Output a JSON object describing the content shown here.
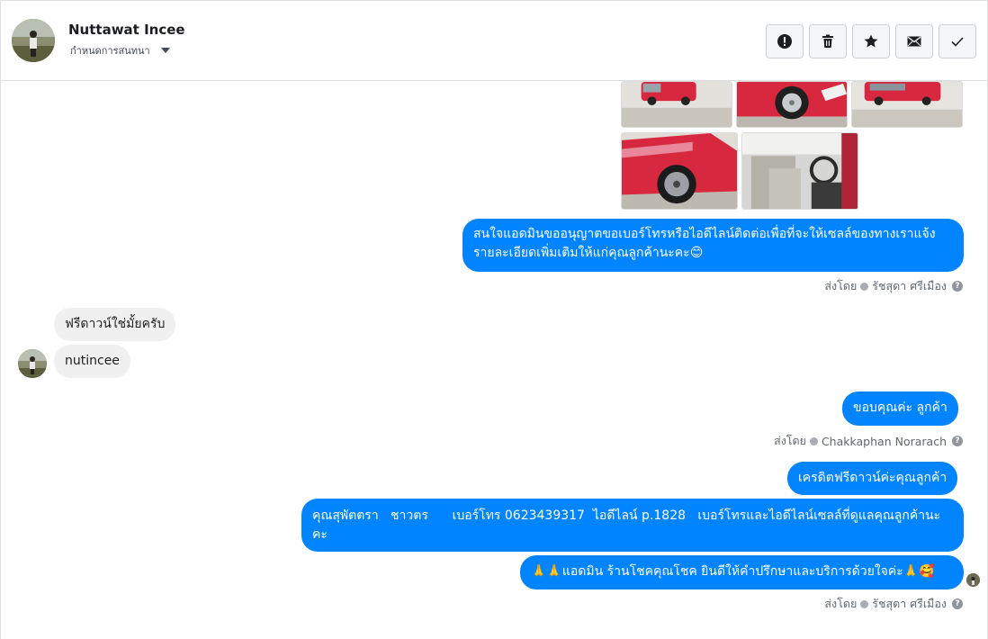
{
  "header": {
    "contact_name": "Nuttawat Incee",
    "assign_label": "กำหนดการสนทนา",
    "toolbar": [
      {
        "name": "report-button",
        "icon": "exclamation-icon"
      },
      {
        "name": "delete-button",
        "icon": "trash-icon"
      },
      {
        "name": "star-button",
        "icon": "star-icon"
      },
      {
        "name": "mail-button",
        "icon": "envelope-icon"
      },
      {
        "name": "done-button",
        "icon": "checkmark-icon"
      }
    ]
  },
  "messages": {
    "m1": "สนใจแอดมินขออนุญาตขอเบอร์โทรหรือไอดีไลน์ติดต่อเพื่อที่จะให้เซลล์ของทางเราแจ้งรายละเอียดเพิ่มเติมให้แก่คุณลูกค้านะคะ😊",
    "m1_sent_prefix": "ส่งโดย",
    "m1_sender": "รัชสุดา ศรีเมือง",
    "in1": "ฟรีดาวน์ใช่มั้ยครับ",
    "in2": "nutincee",
    "m2": "ขอบคุณค่ะ ลูกค้า",
    "m2_sent_prefix": "ส่งโดย",
    "m2_sender": "Chakkaphan Norarach",
    "m3": "เครดิตฟรีดาวน์ค่ะคุณลูกค้า",
    "m4": "คุณสุพัตตรา   ชาวตร      เบอร์โทร 0623439317  ไอดีไลน์ p.1828   เบอร์โทรและไอดีไลน์เซลล์ที่ดูแลคุณลูกค้านะคะ",
    "m5": "🙏🙏แอดมิน ร้านโชคคุณโชค ยินดีให้คำปรึกษาและบริการด้วยใจค่ะ🙏🥰",
    "m5_sent_prefix": "ส่งโดย",
    "m5_sender": "รัชสุดา ศรีเมือง",
    "help_glyph": "?"
  },
  "colors": {
    "outgoing": "#0084ff",
    "incoming": "#f1f0f0",
    "car_red": "#d8283f"
  }
}
